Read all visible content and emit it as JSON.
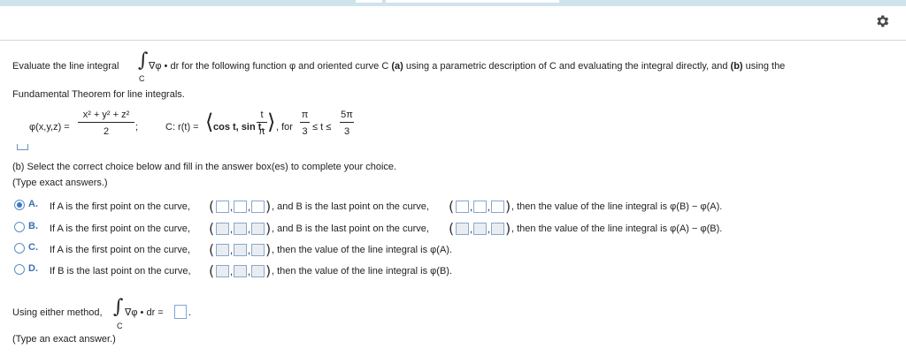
{
  "icons": {
    "settings": "gear-icon"
  },
  "problem": {
    "intro_before": "Evaluate the line integral",
    "intro_integrand": "∇φ • dr for the following function φ and oriented curve C",
    "part_a_label": "(a)",
    "intro_middle": "using a parametric description of C and evaluating the integral directly, and",
    "part_b_label": "(b)",
    "intro_end": "using the",
    "line2": "Fundamental Theorem for line integrals.",
    "integral_sub": "C",
    "phi_label": "φ(x,y,z) =",
    "phi_num": "x² + y² + z²",
    "phi_den": "2",
    "phi_semicolon": ";",
    "curve_label": "C: r(t) =",
    "curve_body": "cos t, sin t,",
    "curve_t_num": "t",
    "curve_t_den": "π",
    "for_text": ", for",
    "lower_num": "π",
    "lower_den": "3",
    "ineq": "≤ t ≤",
    "upper_num": "5π",
    "upper_den": "3"
  },
  "part_b": {
    "heading": "(b) Select the correct choice below and fill in the answer box(es) to complete your choice.",
    "hint": "(Type exact answers.)",
    "options": [
      {
        "letter": "A.",
        "text1": "If A is the first point on the curve,",
        "text2": ", and B is the last point on the curve,",
        "text3": ", then the value of the line integral is φ(B) − φ(A)."
      },
      {
        "letter": "B.",
        "text1": "If A is the first point on the curve,",
        "text2": ", and B is the last point on the curve,",
        "text3": ", then the value of the line integral is φ(A) − φ(B)."
      },
      {
        "letter": "C.",
        "text1": "If A is the first point on the curve,",
        "text3": ", then the value of the line integral is φ(A)."
      },
      {
        "letter": "D.",
        "text1": "If B is the last point on the curve,",
        "text3": ", then the value of the line integral is φ(B)."
      }
    ],
    "selected_option": "A"
  },
  "final": {
    "prefix": "Using either method,",
    "integrand": "∇φ • dr =",
    "sub": "C",
    "period": ".",
    "hint": "(Type an exact answer.)"
  }
}
